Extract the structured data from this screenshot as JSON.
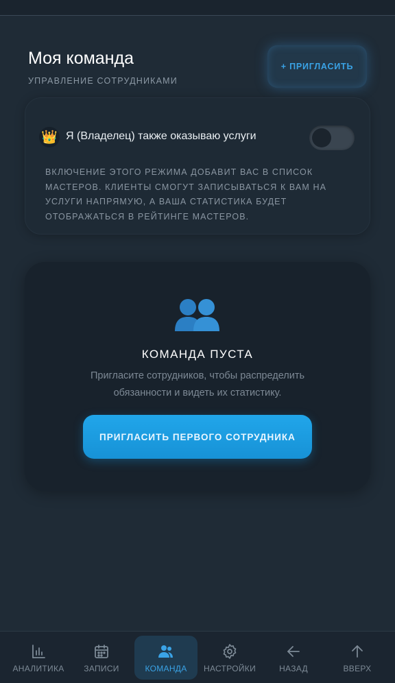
{
  "header": {
    "title": "Моя команда",
    "subtitle": "УПРАВЛЕНИЕ СОТРУДНИКАМИ",
    "invite_label": "+ ПРИГЛАСИТЬ"
  },
  "owner_card": {
    "icon": "crown-icon",
    "label": "Я (Владелец) также оказываю услуги",
    "toggle_on": false,
    "description": "ВКЛЮЧЕНИЕ ЭТОГО РЕЖИМА ДОБАВИТ ВАС В СПИСОК МАСТЕРОВ. КЛИЕНТЫ СМОГУТ ЗАПИСЫВАТЬСЯ К ВАМ НА УСЛУГИ НАПРЯМУЮ, А ВАША СТАТИСТИКА БУДЕТ ОТОБРАЖАТЬСЯ В РЕЙТИНГЕ МАСТЕРОВ."
  },
  "empty_state": {
    "icon": "people-icon",
    "title": "КОМАНДА ПУСТА",
    "text": "Пригласите сотрудников, чтобы распределить обязанности и видеть их статистику.",
    "button_label": "ПРИГЛАСИТЬ ПЕРВОГО СОТРУДНИКА"
  },
  "bottom_nav": {
    "items": [
      {
        "label": "АНАЛИТИКА",
        "icon": "bar-chart-icon",
        "active": false
      },
      {
        "label": "ЗАПИСИ",
        "icon": "calendar-icon",
        "active": false
      },
      {
        "label": "КОМАНДА",
        "icon": "team-icon",
        "active": true
      },
      {
        "label": "НАСТРОЙКИ",
        "icon": "gear-icon",
        "active": false
      },
      {
        "label": "НАЗАД",
        "icon": "arrow-left-icon",
        "active": false
      },
      {
        "label": "ВВЕРХ",
        "icon": "arrow-up-icon",
        "active": false
      }
    ]
  },
  "colors": {
    "background": "#1f2b36",
    "accent": "#1f9fe3",
    "muted_text": "#8a96a2"
  }
}
